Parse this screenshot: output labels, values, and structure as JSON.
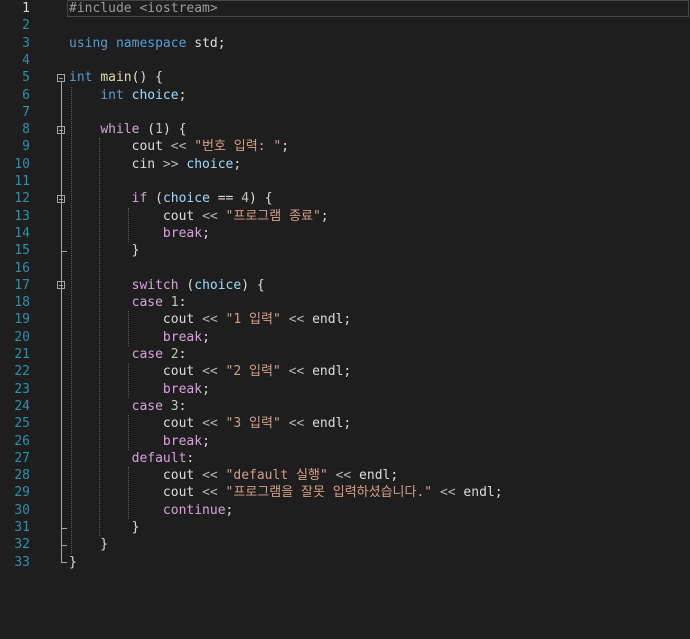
{
  "editor": {
    "current_line": 1,
    "colors": {
      "background": "#1e1e1e",
      "keyword": "#569cd6",
      "control": "#d8a0df",
      "string": "#d69d85",
      "line_number": "#2b91af"
    },
    "lines": [
      {
        "n": "1",
        "tokens": [
          {
            "t": "#include <iostream>",
            "c": "pp"
          }
        ]
      },
      {
        "n": "2",
        "tokens": []
      },
      {
        "n": "3",
        "tokens": [
          {
            "t": "using",
            "c": "kw"
          },
          {
            "t": " "
          },
          {
            "t": "namespace",
            "c": "kw"
          },
          {
            "t": " std;"
          }
        ]
      },
      {
        "n": "4",
        "tokens": []
      },
      {
        "n": "5",
        "tokens": [
          {
            "t": "int",
            "c": "kw"
          },
          {
            "t": " "
          },
          {
            "t": "main",
            "c": "fn"
          },
          {
            "t": "() {"
          }
        ]
      },
      {
        "n": "6",
        "tokens": [
          {
            "t": "    "
          },
          {
            "t": "int",
            "c": "kw"
          },
          {
            "t": " "
          },
          {
            "t": "choice",
            "c": "var"
          },
          {
            "t": ";"
          }
        ]
      },
      {
        "n": "7",
        "tokens": []
      },
      {
        "n": "8",
        "tokens": [
          {
            "t": "    "
          },
          {
            "t": "while",
            "c": "ctl"
          },
          {
            "t": " ("
          },
          {
            "t": "1",
            "c": "num"
          },
          {
            "t": ") {"
          }
        ]
      },
      {
        "n": "9",
        "tokens": [
          {
            "t": "        cout "
          },
          {
            "t": "<<",
            "c": "op"
          },
          {
            "t": " "
          },
          {
            "t": "\"번호 입력: \"",
            "c": "str"
          },
          {
            "t": ";"
          }
        ]
      },
      {
        "n": "10",
        "tokens": [
          {
            "t": "        cin "
          },
          {
            "t": ">>",
            "c": "op"
          },
          {
            "t": " "
          },
          {
            "t": "choice",
            "c": "var"
          },
          {
            "t": ";"
          }
        ]
      },
      {
        "n": "11",
        "tokens": []
      },
      {
        "n": "12",
        "tokens": [
          {
            "t": "        "
          },
          {
            "t": "if",
            "c": "ctl"
          },
          {
            "t": " ("
          },
          {
            "t": "choice",
            "c": "var"
          },
          {
            "t": " == "
          },
          {
            "t": "4",
            "c": "num"
          },
          {
            "t": ") {"
          }
        ]
      },
      {
        "n": "13",
        "tokens": [
          {
            "t": "            cout "
          },
          {
            "t": "<<",
            "c": "op"
          },
          {
            "t": " "
          },
          {
            "t": "\"프로그램 종료\"",
            "c": "str"
          },
          {
            "t": ";"
          }
        ]
      },
      {
        "n": "14",
        "tokens": [
          {
            "t": "            "
          },
          {
            "t": "break",
            "c": "ctl"
          },
          {
            "t": ";"
          }
        ]
      },
      {
        "n": "15",
        "tokens": [
          {
            "t": "        }"
          }
        ]
      },
      {
        "n": "16",
        "tokens": []
      },
      {
        "n": "17",
        "tokens": [
          {
            "t": "        "
          },
          {
            "t": "switch",
            "c": "ctl"
          },
          {
            "t": " ("
          },
          {
            "t": "choice",
            "c": "var"
          },
          {
            "t": ") {"
          }
        ]
      },
      {
        "n": "18",
        "tokens": [
          {
            "t": "        "
          },
          {
            "t": "case",
            "c": "ctl"
          },
          {
            "t": " "
          },
          {
            "t": "1",
            "c": "num"
          },
          {
            "t": ":"
          }
        ]
      },
      {
        "n": "19",
        "tokens": [
          {
            "t": "            cout "
          },
          {
            "t": "<<",
            "c": "op"
          },
          {
            "t": " "
          },
          {
            "t": "\"1 입력\"",
            "c": "str"
          },
          {
            "t": " "
          },
          {
            "t": "<<",
            "c": "op"
          },
          {
            "t": " endl;"
          }
        ]
      },
      {
        "n": "20",
        "tokens": [
          {
            "t": "            "
          },
          {
            "t": "break",
            "c": "ctl"
          },
          {
            "t": ";"
          }
        ]
      },
      {
        "n": "21",
        "tokens": [
          {
            "t": "        "
          },
          {
            "t": "case",
            "c": "ctl"
          },
          {
            "t": " "
          },
          {
            "t": "2",
            "c": "num"
          },
          {
            "t": ":"
          }
        ]
      },
      {
        "n": "22",
        "tokens": [
          {
            "t": "            cout "
          },
          {
            "t": "<<",
            "c": "op"
          },
          {
            "t": " "
          },
          {
            "t": "\"2 입력\"",
            "c": "str"
          },
          {
            "t": " "
          },
          {
            "t": "<<",
            "c": "op"
          },
          {
            "t": " endl;"
          }
        ]
      },
      {
        "n": "23",
        "tokens": [
          {
            "t": "            "
          },
          {
            "t": "break",
            "c": "ctl"
          },
          {
            "t": ";"
          }
        ]
      },
      {
        "n": "24",
        "tokens": [
          {
            "t": "        "
          },
          {
            "t": "case",
            "c": "ctl"
          },
          {
            "t": " "
          },
          {
            "t": "3",
            "c": "num"
          },
          {
            "t": ":"
          }
        ]
      },
      {
        "n": "25",
        "tokens": [
          {
            "t": "            cout "
          },
          {
            "t": "<<",
            "c": "op"
          },
          {
            "t": " "
          },
          {
            "t": "\"3 입력\"",
            "c": "str"
          },
          {
            "t": " "
          },
          {
            "t": "<<",
            "c": "op"
          },
          {
            "t": " endl;"
          }
        ]
      },
      {
        "n": "26",
        "tokens": [
          {
            "t": "            "
          },
          {
            "t": "break",
            "c": "ctl"
          },
          {
            "t": ";"
          }
        ]
      },
      {
        "n": "27",
        "tokens": [
          {
            "t": "        "
          },
          {
            "t": "default",
            "c": "ctl"
          },
          {
            "t": ":"
          }
        ]
      },
      {
        "n": "28",
        "tokens": [
          {
            "t": "            cout "
          },
          {
            "t": "<<",
            "c": "op"
          },
          {
            "t": " "
          },
          {
            "t": "\"default 실행\"",
            "c": "str"
          },
          {
            "t": " "
          },
          {
            "t": "<<",
            "c": "op"
          },
          {
            "t": " endl;"
          }
        ]
      },
      {
        "n": "29",
        "tokens": [
          {
            "t": "            cout "
          },
          {
            "t": "<<",
            "c": "op"
          },
          {
            "t": " "
          },
          {
            "t": "\"프로그램을 잘못 입력하셨습니다.\"",
            "c": "str"
          },
          {
            "t": " "
          },
          {
            "t": "<<",
            "c": "op"
          },
          {
            "t": " endl;"
          }
        ]
      },
      {
        "n": "30",
        "tokens": [
          {
            "t": "            "
          },
          {
            "t": "continue",
            "c": "ctl"
          },
          {
            "t": ";"
          }
        ]
      },
      {
        "n": "31",
        "tokens": [
          {
            "t": "        }"
          }
        ]
      },
      {
        "n": "32",
        "tokens": [
          {
            "t": "    }"
          }
        ]
      },
      {
        "n": "33",
        "tokens": [
          {
            "t": "}"
          }
        ]
      }
    ]
  }
}
